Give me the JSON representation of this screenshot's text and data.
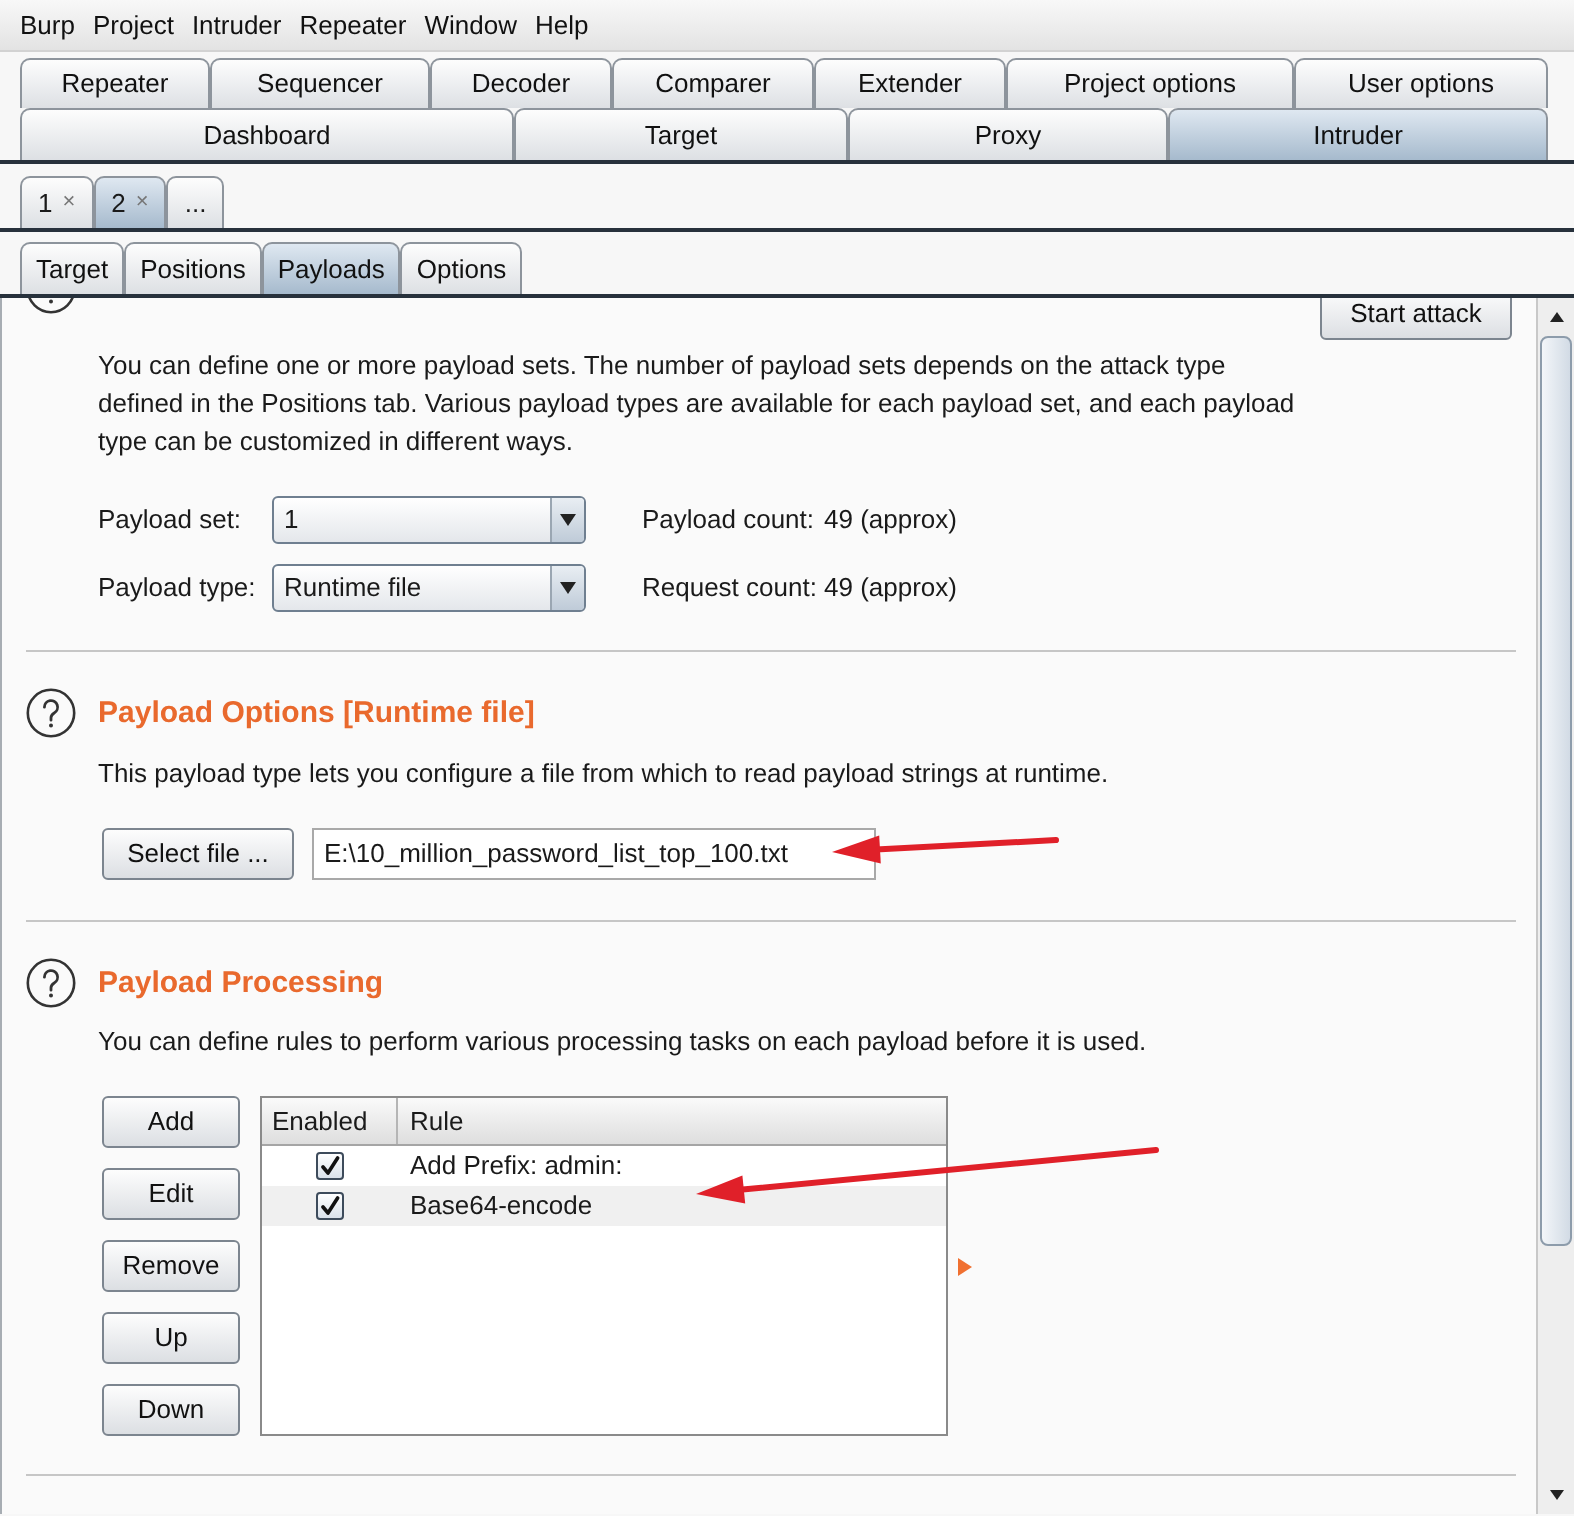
{
  "menu_bar": {
    "items": [
      "Burp",
      "Project",
      "Intruder",
      "Repeater",
      "Window",
      "Help"
    ]
  },
  "tool_tabs": {
    "top_row": [
      {
        "label": "Repeater",
        "selected": false
      },
      {
        "label": "Sequencer",
        "selected": false
      },
      {
        "label": "Decoder",
        "selected": false
      },
      {
        "label": "Comparer",
        "selected": false
      },
      {
        "label": "Extender",
        "selected": false
      },
      {
        "label": "Project options",
        "selected": false
      },
      {
        "label": "User options",
        "selected": false
      }
    ],
    "bottom_row": [
      {
        "label": "Dashboard",
        "selected": false
      },
      {
        "label": "Target",
        "selected": false
      },
      {
        "label": "Proxy",
        "selected": false
      },
      {
        "label": "Intruder",
        "selected": true
      }
    ]
  },
  "attack_tabs": [
    {
      "label": "1",
      "close": "×",
      "selected": false
    },
    {
      "label": "2",
      "close": "×",
      "selected": true
    },
    {
      "label": "...",
      "selected": false
    }
  ],
  "intruder_tabs": [
    {
      "label": "Target",
      "selected": false
    },
    {
      "label": "Positions",
      "selected": false
    },
    {
      "label": "Payloads",
      "selected": true
    },
    {
      "label": "Options",
      "selected": false
    }
  ],
  "payload_sets": {
    "start_button": "Start attack",
    "description": "You can define one or more payload sets. The number of payload sets depends on the attack type defined in the Positions tab. Various payload types are available for each payload set, and each payload type can be customized in different ways.",
    "fields": [
      {
        "label": "Payload set:",
        "value": "1",
        "count_label": "Payload count:",
        "count_value": "49 (approx)"
      },
      {
        "label": "Payload type:",
        "value": "Runtime file",
        "count_label": "Request count:",
        "count_value": "49 (approx)"
      }
    ]
  },
  "payload_options": {
    "title": "Payload Options [Runtime file]",
    "description": "This payload type lets you configure a file from which to read payload strings at runtime.",
    "select_button": "Select file ...",
    "file_path": "E:\\10_million_password_list_top_100.txt"
  },
  "payload_processing": {
    "title": "Payload Processing",
    "description": "You can define rules to perform various processing tasks on each payload before it is used.",
    "buttons": [
      "Add",
      "Edit",
      "Remove",
      "Up",
      "Down"
    ],
    "table": {
      "columns": [
        "Enabled",
        "Rule"
      ],
      "rows": [
        {
          "enabled": true,
          "rule": "Add Prefix: admin:"
        },
        {
          "enabled": true,
          "rule": "Base64-encode"
        }
      ]
    }
  }
}
